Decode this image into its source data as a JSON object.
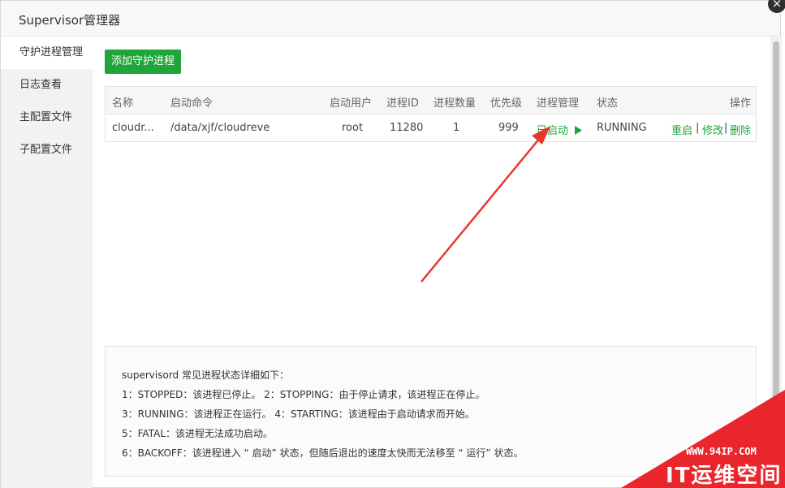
{
  "window": {
    "title": "Supervisor管理器",
    "close_glyph": "×"
  },
  "sidebar": {
    "items": [
      {
        "label": "守护进程管理",
        "active": true
      },
      {
        "label": "日志查看",
        "active": false
      },
      {
        "label": "主配置文件",
        "active": false
      },
      {
        "label": "子配置文件",
        "active": false
      }
    ]
  },
  "toolbar": {
    "add_label": "添加守护进程"
  },
  "table": {
    "headers": [
      "名称",
      "启动命令",
      "启动用户",
      "进程ID",
      "进程数量",
      "优先级",
      "进程管理",
      "状态",
      "操作"
    ],
    "rows": [
      {
        "name": "cloudr...",
        "command": "/data/xjf/cloudreve",
        "user": "root",
        "pid": "11280",
        "count": "1",
        "priority": "999",
        "manage": "已启动",
        "manage_icon": "play-icon",
        "status": "RUNNING",
        "actions": {
          "restart": "重启",
          "sep1": "|",
          "edit": "修改",
          "sep2": "|",
          "delete": "删除"
        }
      }
    ]
  },
  "info": {
    "lines": [
      "supervisord 常见进程状态详细如下：",
      "1：STOPPED：该进程已停止。     2：STOPPING：由于停止请求，该进程正在停止。",
      "3：RUNNING：该进程正在运行。 4：STARTING：该进程由于启动请求而开始。",
      "5：FATAL：该进程无法成功启动。",
      "6：BACKOFF：该进程进入 “ 启动” 状态，但随后退出的速度太快而无法移至 “ 运行” 状态。"
    ]
  },
  "watermark": {
    "url": "WWW.94IP.COM",
    "brand": "IT运维空间"
  },
  "colors": {
    "accent": "#20a53a",
    "annotation_arrow": "#e8372c",
    "watermark": "#e8262b"
  }
}
